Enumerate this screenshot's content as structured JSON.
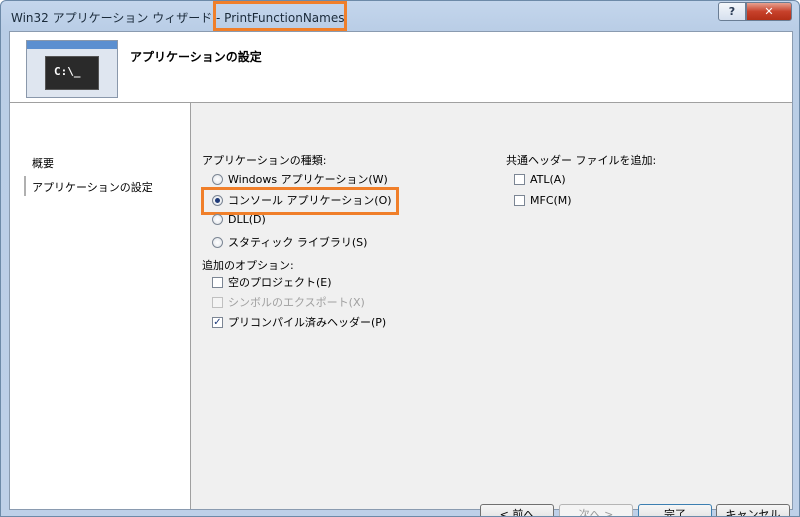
{
  "window": {
    "title_prefix": "Win32 アプリケーション ウィザード - ",
    "title_project": "PrintFunctionNames",
    "help_label": "?",
    "close_label": "✕"
  },
  "header": {
    "title": "アプリケーションの設定",
    "thumbnail_icon": "console-window-icon",
    "thumbnail_glyph": "C:\\_"
  },
  "nav": {
    "items": [
      {
        "label": "概要"
      },
      {
        "label": "アプリケーションの設定"
      }
    ]
  },
  "app_type": {
    "label": "アプリケーションの種類:",
    "options": [
      {
        "label": "Windows アプリケーション(W)",
        "selected": false
      },
      {
        "label": "コンソール アプリケーション(O)",
        "selected": true
      },
      {
        "label": "DLL(D)",
        "selected": false
      },
      {
        "label": "スタティック ライブラリ(S)",
        "selected": false
      }
    ]
  },
  "extra_options": {
    "label": "追加のオプション:",
    "options": [
      {
        "label": "空のプロジェクト(E)",
        "checked": false,
        "enabled": true
      },
      {
        "label": "シンボルのエクスポート(X)",
        "checked": false,
        "enabled": false
      },
      {
        "label": "プリコンパイル済みヘッダー(P)",
        "checked": true,
        "enabled": true
      }
    ]
  },
  "common_headers": {
    "label": "共通ヘッダー ファイルを追加:",
    "options": [
      {
        "label": "ATL(A)",
        "checked": false
      },
      {
        "label": "MFC(M)",
        "checked": false
      }
    ]
  },
  "buttons": {
    "prev": "< 前へ",
    "next": "次へ >",
    "finish": "完了",
    "cancel": "キャンセル"
  },
  "colors": {
    "highlight": "#f07f2a",
    "titlebar": "#c4d6ec",
    "close_button": "#c7412b"
  }
}
